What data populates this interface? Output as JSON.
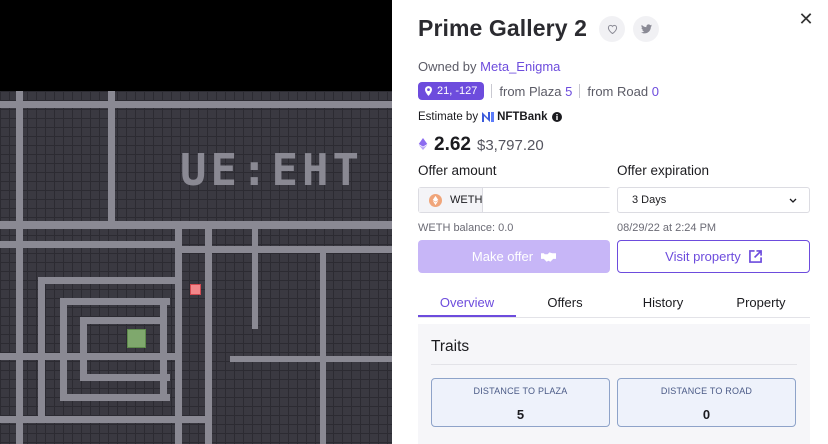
{
  "map": {
    "plaza_text": "UE:EHT"
  },
  "detail": {
    "title": "Prime Gallery 2",
    "owner_prefix": "Owned by",
    "owner_name": "Meta_Enigma",
    "coords": "21, -127",
    "from_plaza_label": "from Plaza",
    "from_plaza_value": "5",
    "from_road_label": "from Road",
    "from_road_value": "0",
    "estimate_label": "Estimate by",
    "estimate_provider": "NFTBank",
    "price": "2.62",
    "price_usd": "$3,797.20",
    "offer_amount_label": "Offer amount",
    "offer_token": "WETH",
    "offer_amount_value": "",
    "weth_balance": "WETH balance: 0.0",
    "offer_expiration_label": "Offer expiration",
    "expiration_selected": "3 Days",
    "expiration_date": "08/29/22 at 2:24 PM",
    "make_offer_label": "Make offer",
    "visit_property_label": "Visit property",
    "tabs": [
      {
        "label": "Overview"
      },
      {
        "label": "Offers"
      },
      {
        "label": "History"
      },
      {
        "label": "Property"
      }
    ],
    "traits_title": "Traits",
    "traits": [
      {
        "type": "DISTANCE TO PLAZA",
        "value": "5"
      },
      {
        "type": "DISTANCE TO ROAD",
        "value": "0"
      }
    ]
  },
  "colors": {
    "accent": "#6d4cdd",
    "accent_light": "#c7b6f7",
    "map_road": "#8a8993",
    "map_block": "#3a3941",
    "parcel_selected": "#f2878a",
    "parcel_plaza": "#7fa86d"
  }
}
